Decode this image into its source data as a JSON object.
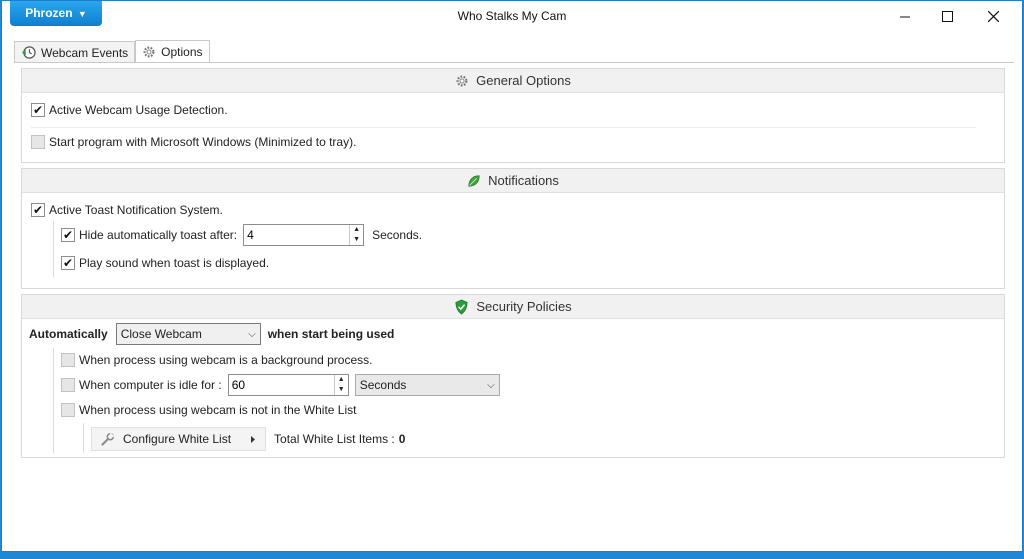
{
  "window": {
    "title": "Who Stalks My Cam",
    "brand_label": "Phrozen",
    "brand_caret": "▼"
  },
  "tabs": [
    {
      "label": "Webcam Events",
      "icon": "clock-arrow-icon"
    },
    {
      "label": "Options",
      "icon": "gear-icon"
    }
  ],
  "general": {
    "header": "General Options",
    "active_detection": {
      "label": "Active Webcam Usage Detection.",
      "checked": true
    },
    "start_with_windows": {
      "label": "Start program with Microsoft Windows (Minimized to tray).",
      "checked": false
    }
  },
  "notifications": {
    "header": "Notifications",
    "toast_system": {
      "label": "Active Toast Notification System.",
      "checked": true
    },
    "hide_toast": {
      "label": "Hide automatically toast after:",
      "checked": true,
      "value": "4",
      "suffix": "Seconds."
    },
    "play_sound": {
      "label": "Play sound when toast is displayed.",
      "checked": true
    }
  },
  "security": {
    "header": "Security Policies",
    "automatically_label": "Automatically",
    "action_value": "Close Webcam",
    "when_label": "when start being used",
    "background_process": {
      "label": "When process using webcam is a background process.",
      "checked": false
    },
    "idle": {
      "label": "When computer is idle for :",
      "checked": false,
      "value": "60",
      "unit": "Seconds"
    },
    "not_whitelist": {
      "label": "When process using webcam is not in the White List",
      "checked": false
    },
    "configure_label": "Configure White List",
    "total_label": "Total  White List Items :",
    "total_value": "0"
  },
  "colors": {
    "accent": "#1e88d4",
    "brand_button": "#1b8fe0",
    "leaf_green": "#3aa53a",
    "shield_green": "#2e9b3e"
  }
}
